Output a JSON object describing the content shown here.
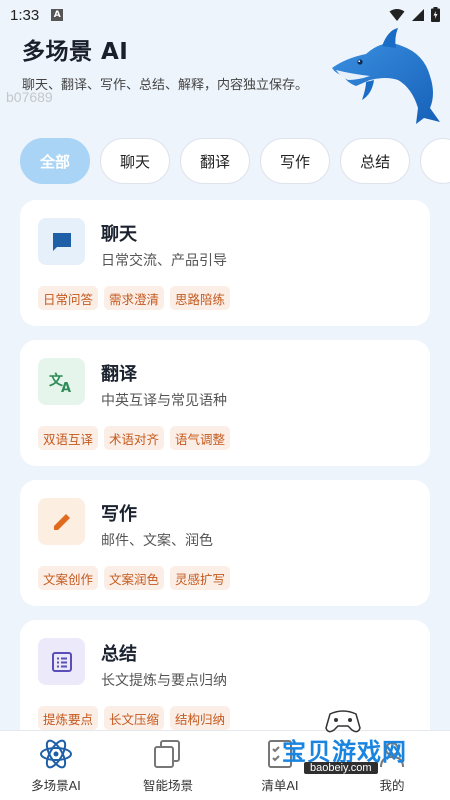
{
  "status_bar": {
    "time": "1:33",
    "notif_letter": "A"
  },
  "header": {
    "title": "多场景 AI",
    "subtitle": "聊天、翻译、写作、总结、解释，内容独立保存。",
    "watermark_code": "b07689"
  },
  "filters": [
    {
      "label": "全部",
      "active": true
    },
    {
      "label": "聊天",
      "active": false
    },
    {
      "label": "翻译",
      "active": false
    },
    {
      "label": "写作",
      "active": false
    },
    {
      "label": "总结",
      "active": false
    }
  ],
  "scenes": [
    {
      "title": "聊天",
      "desc": "日常交流、产品引导",
      "icon": "chat-bubble-icon",
      "color": "#1f5fa8",
      "icon_bg": "#e6f0fa",
      "tags": [
        "日常问答",
        "需求澄清",
        "思路陪练"
      ]
    },
    {
      "title": "翻译",
      "desc": "中英互译与常见语种",
      "icon": "translate-icon",
      "color": "#2e8b57",
      "icon_bg": "#e6f5ec",
      "tags": [
        "双语互译",
        "术语对齐",
        "语气调整"
      ]
    },
    {
      "title": "写作",
      "desc": "邮件、文案、润色",
      "icon": "pencil-icon",
      "color": "#e06a1d",
      "icon_bg": "#fdeee2",
      "tags": [
        "文案创作",
        "文案润色",
        "灵感扩写"
      ]
    },
    {
      "title": "总结",
      "desc": "长文提炼与要点归纳",
      "icon": "list-icon",
      "color": "#5a4fb8",
      "icon_bg": "#ebe9fa",
      "tags": [
        "提炼要点",
        "长文压缩",
        "结构归纳"
      ]
    }
  ],
  "bottom_nav": [
    {
      "label": "多场景AI",
      "icon": "atom-icon",
      "active": true
    },
    {
      "label": "智能场景",
      "icon": "copy-stack-icon",
      "active": false
    },
    {
      "label": "清单AI",
      "icon": "checklist-icon",
      "active": false
    },
    {
      "label": "我的",
      "icon": "profile-icon",
      "active": false
    }
  ],
  "stamp": {
    "text": "宝贝游戏网",
    "url": "baobeiy.com"
  },
  "colors": {
    "accent": "#1a85e0",
    "chip_active": "#a9d4f6",
    "tag_bg": "#fbeee6",
    "tag_text": "#c45a1f"
  }
}
